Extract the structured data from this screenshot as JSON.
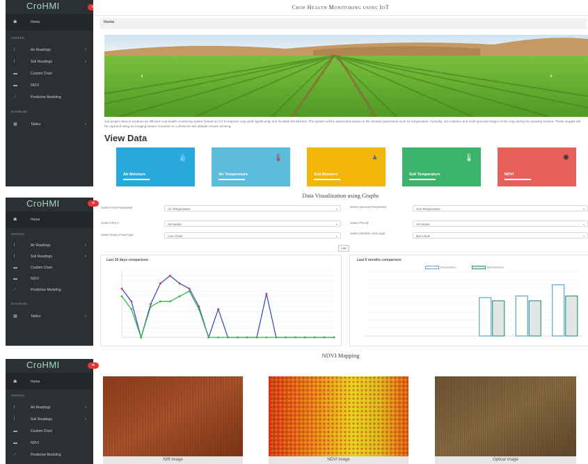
{
  "app": {
    "brand": "CroHMI",
    "title": "Crop Health Monitoring using IoT",
    "breadcrumb": "Home"
  },
  "sidebar": {
    "home": "Home",
    "graphs_section": "GRAPHS",
    "items": [
      {
        "label": "Air Readings",
        "icon": "chart-icon",
        "has_submenu": true
      },
      {
        "label": "Soil Readings",
        "icon": "chart-icon",
        "has_submenu": true
      },
      {
        "label": "Custom Chart",
        "icon": "bar-chart-icon",
        "has_submenu": false
      },
      {
        "label": "NDVI",
        "icon": "bar-chart-icon",
        "has_submenu": false
      },
      {
        "label": "Predictive Modeling",
        "icon": "line-chart-icon",
        "has_submenu": false
      }
    ],
    "database_section": "DATABASE",
    "tables": "Tables"
  },
  "dashboard": {
    "description": "Our project aims to produce an efficient crop health monitoring system based on IoT to improve crop yield significantly and facilitate the farmers. The system will be automated based on the sensed parameters such as temperature, humidity, soil moisture and multi-spectral images of the crop during the growing season. These images will be captured using an imaging sensor mounted on a drone for low altitude remote sensing.",
    "view_data_heading": "View Data",
    "cards": [
      {
        "label": "Air Moisture",
        "color": "#29a8dc",
        "icon": "water-drop-icon"
      },
      {
        "label": "Air Temperature",
        "color": "#5bbcdb",
        "icon": "thermometer-icon"
      },
      {
        "label": "Soil Moisture",
        "color": "#f2b509",
        "icon": "soil-drop-icon"
      },
      {
        "label": "Soil Temperature",
        "color": "#3cb36b",
        "icon": "thermometer-icon"
      },
      {
        "label": "NDVI",
        "color": "#e8605c",
        "icon": "satellite-icon"
      }
    ]
  },
  "graphs": {
    "section_title": "Data Visualization using Graphs",
    "form": {
      "first_param_label": "Select First Parameter",
      "first_param_value": "Air Temperature",
      "second_param_label": "Select Second Parameter",
      "second_param_value": "Soil Temperature",
      "plot_a_label": "Select Plot A",
      "plot_a_value": "All Nodes",
      "plot_b_label": "Select Plot B",
      "plot_b_value": "All Nodes",
      "days_chart_label": "Select Days Chart type",
      "days_chart_value": "Line Chart",
      "months_chart_label": "Select Months chart type",
      "months_chart_value": "Bar Chart",
      "run_button": "Lok"
    },
    "left_chart_title": "Last 30 days comparison",
    "right_chart_title": "Last 6 months comparison",
    "right_legend": [
      "airTemperature",
      "soilTemperature"
    ]
  },
  "chart_data": [
    {
      "type": "line",
      "title": "Last 30 days comparison",
      "ylabel": "",
      "ylim": [
        0,
        26
      ],
      "series": [
        {
          "color": "#3f4bc9",
          "values": [
            19,
            14,
            0,
            13,
            21,
            24,
            21,
            19,
            12,
            0,
            11,
            0,
            0,
            0,
            0,
            17,
            0,
            0,
            0,
            0,
            0,
            0,
            0
          ]
        },
        {
          "color": "#38b548",
          "values": [
            16,
            11,
            0,
            12,
            14,
            14,
            16,
            18,
            11,
            0,
            0,
            0,
            0,
            0,
            0,
            0,
            0,
            0,
            0,
            0,
            0,
            0,
            0
          ]
        }
      ]
    },
    {
      "type": "bar",
      "title": "Last 6 months comparison",
      "ylim": [
        0,
        40
      ],
      "series": [
        {
          "name": "airTemperature",
          "values": [
            0,
            0,
            0,
            24,
            25,
            32
          ]
        },
        {
          "name": "soilTemperature",
          "values": [
            0,
            0,
            0,
            22,
            22,
            25
          ]
        }
      ]
    }
  ],
  "ndvi": {
    "section_title": "NDVI Mapping",
    "images": [
      {
        "caption": "NIR image"
      },
      {
        "caption": "NDVI image"
      },
      {
        "caption": "Optical image"
      }
    ]
  }
}
